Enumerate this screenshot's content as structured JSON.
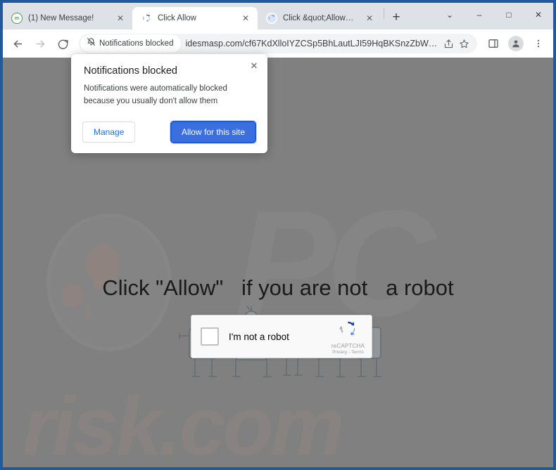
{
  "window": {
    "controls": [
      {
        "name": "tab-search-button",
        "glyph": "⌄"
      },
      {
        "name": "minimize-button",
        "glyph": "–"
      },
      {
        "name": "maximize-button",
        "glyph": "□"
      },
      {
        "name": "close-window-button",
        "glyph": "✕"
      }
    ]
  },
  "tabs": [
    {
      "title": "(1) New Message!",
      "favicon": "mail-icon",
      "active": false,
      "close_glyph": "✕"
    },
    {
      "title": "Click Allow",
      "favicon": "recaptcha-icon",
      "active": true,
      "close_glyph": "✕"
    },
    {
      "title": "Click &quot;Allow&quot;",
      "favicon": "recaptcha-icon",
      "active": false,
      "close_glyph": "✕"
    }
  ],
  "new_tab_label": "+",
  "toolbar": {
    "back_label": "←",
    "forward_label": "→",
    "reload_label": "⟳",
    "notifications_chip": {
      "label": "Notifications blocked",
      "icon": "bell-slash-icon"
    },
    "url": "idesmasp.com/cf67KdXlloIYZCSp5BhLautLJI59HqBKSnzZbW5lhsc?cid=…",
    "share_icon": "share-icon",
    "bookmark_icon": "star-icon",
    "side_panel_icon": "side-panel-icon",
    "profile_icon": "avatar-icon",
    "menu_icon": "three-dot-menu-icon"
  },
  "notification_bubble": {
    "title": "Notifications blocked",
    "body": "Notifications were automatically blocked because you usually don't allow them",
    "manage_label": "Manage",
    "allow_label": "Allow for this site",
    "close_glyph": "✕",
    "allow_button_color": "#3b6fe0",
    "manage_link_color": "#1a73e8"
  },
  "page": {
    "background_color": "#808080",
    "headline": "Click \"Allow\"   if you are not   a robot",
    "watermark_top": "PC",
    "watermark_bottom": "risk.com",
    "recaptcha": {
      "label": "I'm not a robot",
      "brand_name": "reCAPTCHA",
      "brand_legal": "Privacy - Terms",
      "checked": false
    }
  }
}
